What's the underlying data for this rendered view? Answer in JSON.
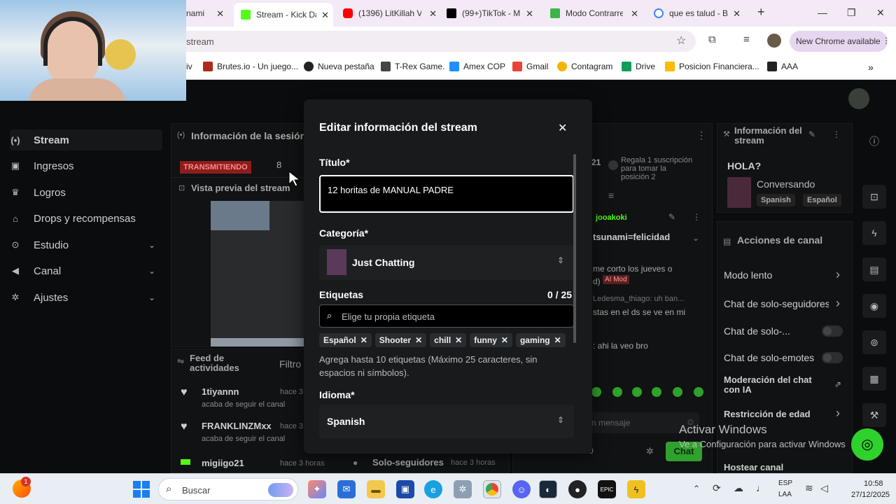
{
  "browser": {
    "tabs": [
      {
        "label": "nami",
        "color": "#555555"
      },
      {
        "label": "Stream - Kick Da",
        "color": "#53fc18"
      },
      {
        "label": "(1396) LitKillah V",
        "color": "#ff0000"
      },
      {
        "label": "(99+)TikTok - M",
        "color": "#000000"
      },
      {
        "label": "Modo Contrarre",
        "color": "#3bb54a"
      },
      {
        "label": "que es talud - Bu",
        "color": "#4285f4"
      }
    ],
    "url": "stream",
    "new_chrome": "New Chrome available",
    "bookmarks": [
      "iv",
      "Brutes.io - Un juego...",
      "Nueva pestaña",
      "T-Rex Game.",
      "Amex COP",
      "Gmail",
      "Contagram",
      "Drive",
      "Posicion Financiera...",
      "AAA"
    ]
  },
  "sidebar": {
    "items": [
      {
        "label": "Stream",
        "icon": "broadcast-icon",
        "glyph": "(•)"
      },
      {
        "label": "Ingresos",
        "icon": "wallet-icon",
        "glyph": "▣"
      },
      {
        "label": "Logros",
        "icon": "trophy-icon",
        "glyph": "♛"
      },
      {
        "label": "Drops y recompensas",
        "icon": "gift-icon",
        "glyph": "⌂"
      },
      {
        "label": "Estudio",
        "icon": "studio-icon",
        "glyph": "⊙"
      },
      {
        "label": "Canal",
        "icon": "megaphone-icon",
        "glyph": "◀"
      },
      {
        "label": "Ajustes",
        "icon": "gear-icon",
        "glyph": "✲"
      }
    ]
  },
  "session": {
    "title": "Información de la sesión",
    "badge": "TRANSMITIENDO",
    "viewers": "8",
    "preview_title": "Vista previa del stream"
  },
  "activity": {
    "title": "Feed de actividades",
    "filter": "Filtro",
    "rows": [
      {
        "name": "1tiyannn",
        "time": "hace 3",
        "action": "acaba de seguir el canal"
      },
      {
        "name": "FRANKLINZMxx",
        "time": "hace 3",
        "action": "acaba de seguir el canal"
      },
      {
        "name": "migiigo21",
        "time": "hace 3 horas",
        "action": ""
      }
    ],
    "extra": {
      "name": "Solo-seguidores",
      "time": "hace 3 horas"
    }
  },
  "chat": {
    "top_count": "21",
    "gift_text": "Regala 1 suscripción para tomar la posición 2",
    "pinned_user": "jooakoki",
    "pinned_msg": "tsunami=felicidad",
    "msgs": [
      "me corto los jueves o",
      "d)",
      "Ledesma_thiago: uh ban...",
      "stas en el ds se ve en mi",
      ": ahi la veo bro"
    ],
    "ai_mod": "AI Mod",
    "placeholder": "n mensaje",
    "send": "Chat",
    "bottom_count": "0"
  },
  "stream_info": {
    "title": "Información del stream",
    "heading": "HOLA?",
    "category": "Conversando",
    "tags": [
      "Spanish",
      "Español"
    ]
  },
  "channel_actions": {
    "title": "Acciones de canal",
    "items": [
      "Modo lento",
      "Chat de solo-seguidores",
      "Chat de solo-...",
      "Chat de solo-emotes",
      "Moderación del chat con IA",
      "Restricción de edad",
      "Hostear canal"
    ]
  },
  "modal": {
    "title": "Editar información del stream",
    "title_label": "Título*",
    "title_value": "12 horitas de MANUAL PADRE",
    "category_label": "Categoría*",
    "category_value": "Just Chatting",
    "tags_label": "Etiquetas",
    "tags_count": "0 / 25",
    "tags_placeholder": "Elige tu propia etiqueta",
    "tags": [
      "Español",
      "Shooter",
      "chill",
      "funny",
      "gaming"
    ],
    "tags_help": "Agrega hasta 10 etiquetas (Máximo 25 caracteres, sin espacios ni símbolos).",
    "language_label": "Idioma*",
    "language_value": "Spanish"
  },
  "windows": {
    "activate_title": "Activar Windows",
    "activate_sub": "Ve a Configuración para activar Windows",
    "search": "Buscar",
    "lang": "ESP",
    "region": "LAA",
    "time": "10:58",
    "date": "27/12/2025",
    "notif_badge": "1"
  }
}
